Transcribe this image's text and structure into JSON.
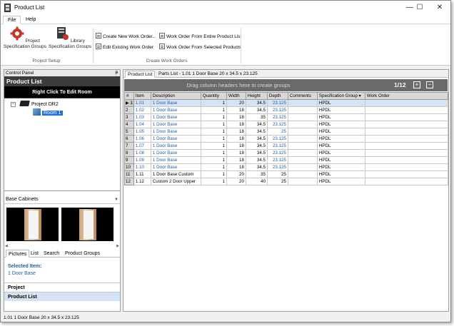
{
  "window": {
    "title": "Product List",
    "minimize_glyph": "—",
    "maximize_glyph": "☐",
    "close_glyph": "✕"
  },
  "menu": {
    "file": "File",
    "help": "Help"
  },
  "ribbon": {
    "project_spec_groups": "Project Specification Groups",
    "library_spec_groups": "Library Specification Groups",
    "project_setup_label": "Project Setup",
    "create_new_work_order": "Create New Work Order...",
    "edit_existing_work_order": "Edit Existing Work Order",
    "wo_from_entire_list": "Work Order From Entire Product List",
    "wo_from_selected": "Work Order From Selected Products",
    "create_work_orders_label": "Create Work Orders"
  },
  "control_panel": {
    "header": "Control Panel",
    "pin_glyph": "ᵽ",
    "title": "Product List",
    "hint": "Right Click To Edit Room",
    "tree": {
      "expander": "−",
      "project": "Project DR2",
      "room": "Room 1"
    },
    "category": "Base Cabinets",
    "tabs": [
      "Pictures",
      "List",
      "Search",
      "Product Groups"
    ],
    "selected_item_label": "Selected Item:",
    "selected_item_value": "1 Door Base",
    "nav_project": "Project",
    "nav_product_list": "Product List"
  },
  "main": {
    "tabs": [
      "Product List",
      "Parts List - 1.01 1 Door Base 20 x 34.5 x 23.125"
    ],
    "group_hint": "Drag column headers here to create groups",
    "pager": "1/12",
    "columns": [
      "#",
      "Item",
      "Description",
      "Quantity",
      "Width",
      "Height",
      "Depth",
      "Comments",
      "Specification Group",
      "Work Order"
    ],
    "rows": [
      [
        "1",
        "1.01",
        "1 Door Base",
        "1",
        "20",
        "34.5",
        "23.125",
        "",
        "HPDL",
        ""
      ],
      [
        "2",
        "1.02",
        "1 Door Base",
        "1",
        "18",
        "34.5",
        "23.125",
        "",
        "HPDL",
        ""
      ],
      [
        "3",
        "1.03",
        "1 Door Base",
        "1",
        "18",
        "35",
        "23.125",
        "",
        "HPDL",
        ""
      ],
      [
        "4",
        "1.04",
        "1 Door Base",
        "1",
        "18",
        "34.5",
        "23.125",
        "",
        "HPDL",
        ""
      ],
      [
        "5",
        "1.05",
        "1 Door Base",
        "1",
        "18",
        "34.5",
        "25",
        "",
        "HPDL",
        ""
      ],
      [
        "6",
        "1.06",
        "1 Door Base",
        "1",
        "18",
        "34.5",
        "23.125",
        "",
        "HPDL",
        ""
      ],
      [
        "7",
        "1.07",
        "1 Door Base",
        "1",
        "18",
        "34.5",
        "23.125",
        "",
        "HPDL",
        ""
      ],
      [
        "8",
        "1.08",
        "1 Door Base",
        "1",
        "18",
        "34.5",
        "23.125",
        "",
        "HPDL",
        ""
      ],
      [
        "9",
        "1.09",
        "1 Door Base",
        "1",
        "18",
        "34.5",
        "23.125",
        "",
        "HPDL",
        ""
      ],
      [
        "10",
        "1.10",
        "1 Door Base",
        "1",
        "18",
        "34.5",
        "23.125",
        "",
        "HPDL",
        ""
      ],
      [
        "11",
        "1.11",
        "1 Door Base Custom",
        "1",
        "20",
        "35",
        "25",
        "",
        "HPDL",
        ""
      ],
      [
        "12",
        "1.12",
        "Custom 2 Door Upper",
        "1",
        "20",
        "40",
        "25",
        "",
        "HPDL",
        ""
      ]
    ]
  },
  "status": "1.01 1 Door Base 20 x 34.5 x 23.125",
  "colors": {
    "accent": "#1e6fe0",
    "link": "#1f5ea8",
    "panel_title": "#3c3c3c",
    "group_bar": "#6a6a6a"
  },
  "icons": [
    "app-icon",
    "gear-icon",
    "library-icon",
    "new-work-order-icon",
    "edit-work-order-icon",
    "folder-icon",
    "room-icon",
    "plus-icon",
    "minus-icon",
    "pin-icon"
  ]
}
